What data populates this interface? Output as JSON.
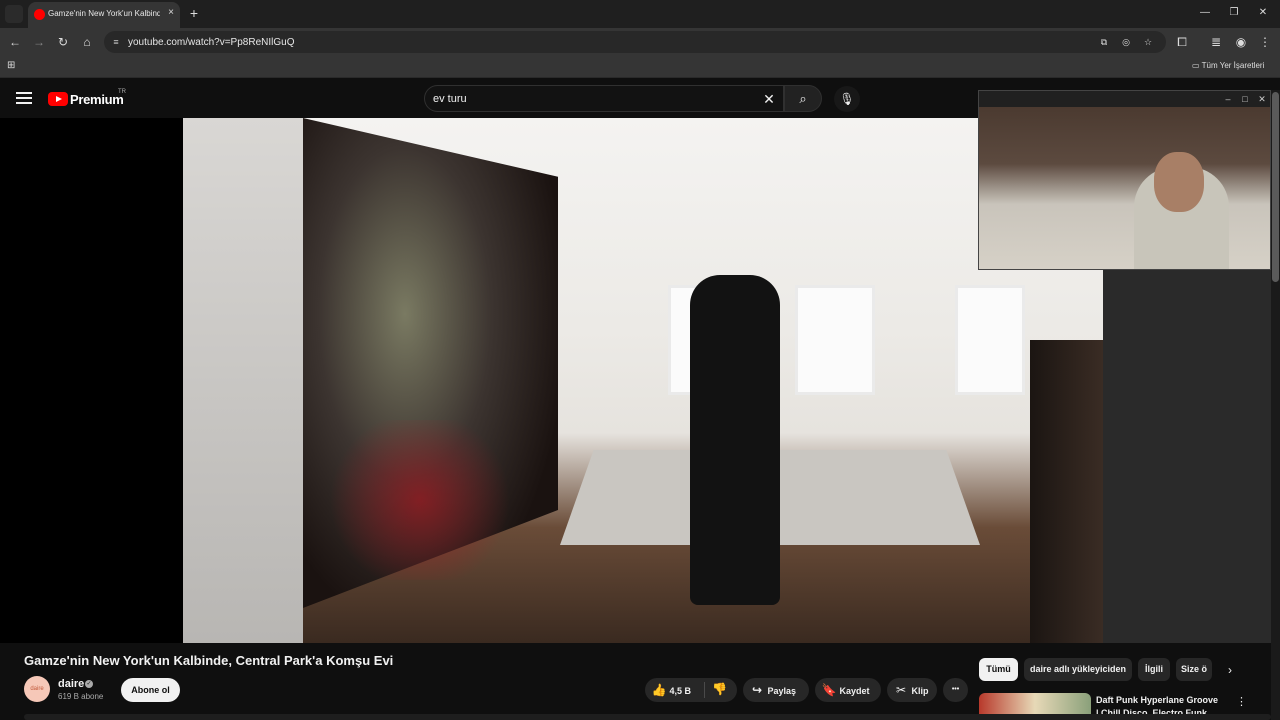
{
  "browser": {
    "tab_title": "Gamze'nin New York'un Kalbinde",
    "tab_close": "×",
    "new_tab": "+",
    "url": "youtube.com/watch?v=Pp8ReNIlGuQ",
    "all_bookmarks": "Tüm Yer İşaretleri",
    "window_controls": {
      "minimize": "—",
      "restore": "❐",
      "close": "✕"
    }
  },
  "youtube": {
    "brand": "Premium",
    "region": "TR",
    "search": {
      "value": "ev turu",
      "placeholder": "Ara"
    }
  },
  "video": {
    "title": "Gamze'nin New York'un Kalbinde, Central Park'a Komşu Evi",
    "channel": {
      "avatar_text": "daire",
      "name": "daire",
      "subscribers": "619 B abone"
    },
    "subscribe_label": "Abone ol",
    "actions": {
      "likes": "4,5 B",
      "share": "Paylaş",
      "save": "Kaydet",
      "clip": "Klip",
      "more": "•••"
    }
  },
  "chips": [
    "Tümü",
    "daire adlı yükleyiciden",
    "İlgili",
    "Size ö"
  ],
  "recommendation": {
    "line1": "Daft Punk Hyperlane Groove",
    "line2": "| Chill Disco, Electro Funk, ..."
  },
  "icons": {
    "back": "←",
    "forward": "→",
    "reload": "↻",
    "home": "⌂",
    "search": "⌕",
    "mic": "🎙",
    "clear": "✕",
    "like": "👍",
    "dislike": "👎",
    "share": "↪",
    "save": "🔖",
    "clip": "✂",
    "chevron": "›"
  }
}
